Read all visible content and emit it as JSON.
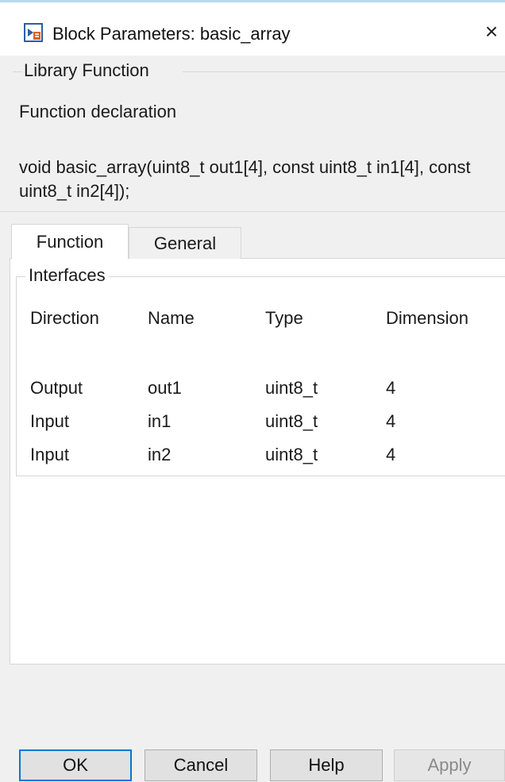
{
  "window": {
    "title": "Block Parameters: basic_array",
    "close_glyph": "×",
    "app_icon": "simulink-block-icon"
  },
  "library_function": {
    "group_title": "Library Function",
    "declaration_label": "Function declaration",
    "signature": "void basic_array(uint8_t out1[4], const uint8_t in1[4], const uint8_t in2[4]);"
  },
  "tabs": [
    {
      "label": "Function",
      "active": true
    },
    {
      "label": "General",
      "active": false
    }
  ],
  "interfaces": {
    "group_title": "Interfaces",
    "headers": [
      "Direction",
      "Name",
      "Type",
      "Dimension"
    ],
    "rows": [
      [
        "Output",
        "out1",
        "uint8_t",
        "4"
      ],
      [
        "Input",
        "in1",
        "uint8_t",
        "4"
      ],
      [
        "Input",
        "in2",
        "uint8_t",
        "4"
      ]
    ]
  },
  "buttons": {
    "ok": "OK",
    "cancel": "Cancel",
    "help": "Help",
    "apply": "Apply"
  },
  "colors": {
    "default_button_border": "#0078d7",
    "disabled_text": "#8a8a8a",
    "dialog_background": "#f0f0f0"
  }
}
